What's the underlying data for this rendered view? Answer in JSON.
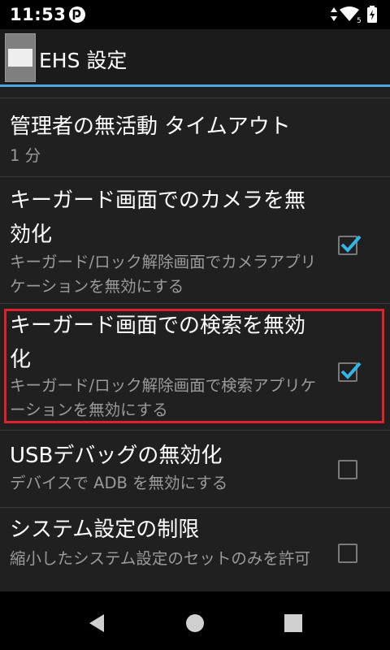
{
  "status_bar": {
    "time": "11:53",
    "notification_icon": "app-notification-icon",
    "icons": [
      "signal-icon",
      "wifi-icon",
      "battery-icon"
    ]
  },
  "action_bar": {
    "title": "EHS 設定",
    "icon": "ehs-app-icon"
  },
  "settings": [
    {
      "title": "管理者の無活動 タイムアウト",
      "summary": "1 分",
      "has_checkbox": false
    },
    {
      "title": "キーガード画面でのカメラを無効化",
      "summary": "キーガード/ロック解除画面でカメラアプリケーションを無効にする",
      "has_checkbox": true,
      "checked": true
    },
    {
      "title": "キーガード画面での検索を無効化",
      "summary": "キーガード/ロック解除画面で検索アプリケーションを無効にする",
      "has_checkbox": true,
      "checked": true,
      "highlighted": true
    },
    {
      "title": "USBデバッグの無効化",
      "summary": "デバイスで ADB を無効にする",
      "has_checkbox": true,
      "checked": false
    },
    {
      "title": "システム設定の制限",
      "summary": "縮小したシステム設定のセットのみを許可",
      "has_checkbox": true,
      "checked": false
    }
  ],
  "nav_bar": {
    "buttons": [
      "back-icon",
      "home-icon",
      "recents-icon"
    ]
  },
  "colors": {
    "accent": "#4aa9e0",
    "highlight_border": "#e0202a",
    "check": "#33b5e5"
  }
}
